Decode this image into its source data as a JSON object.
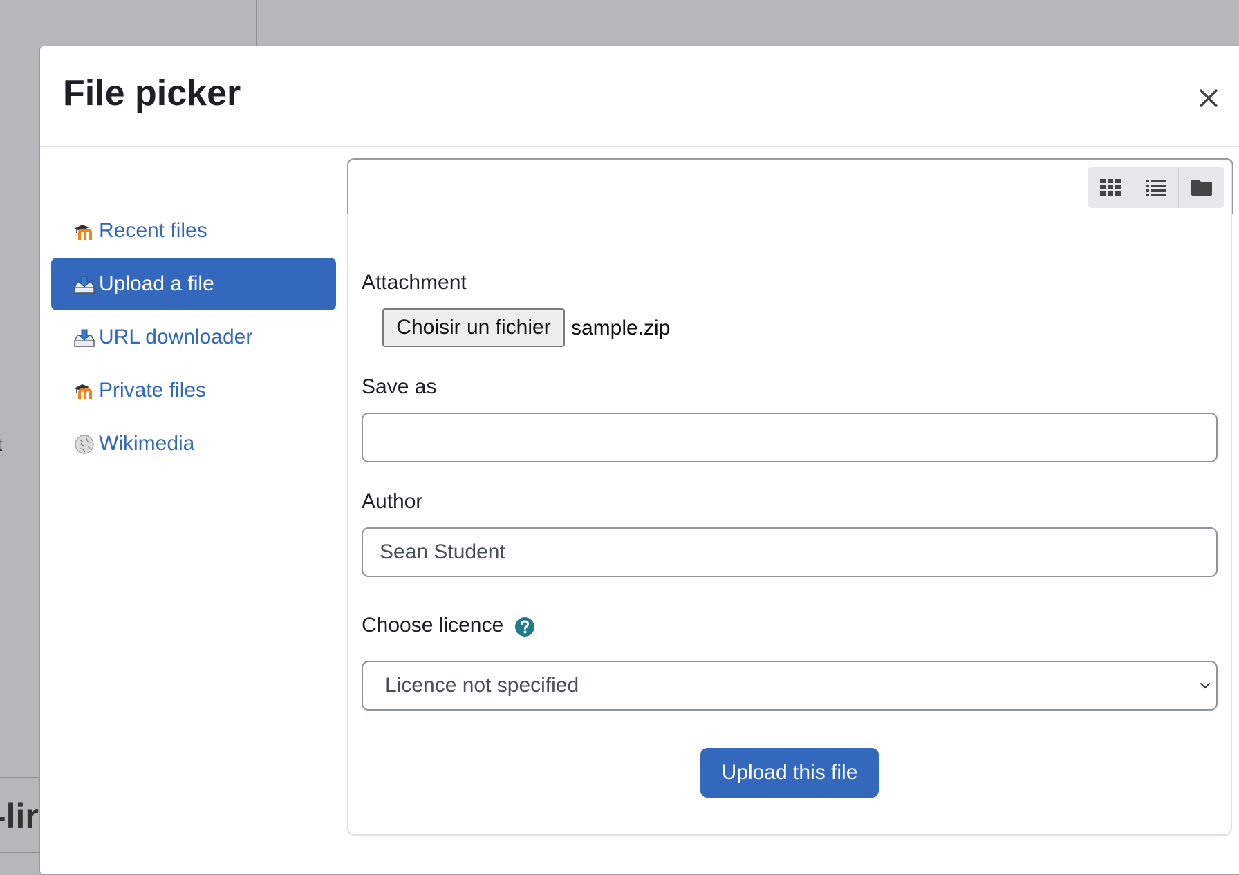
{
  "background": {
    "partial_text_bottom": "-lir",
    "partial_text_mid": "t"
  },
  "dialog": {
    "title": "File picker",
    "close_label": "×"
  },
  "repositories": [
    {
      "label": "Recent files",
      "icon": "moodle-icon",
      "active": false
    },
    {
      "label": "Upload a file",
      "icon": "upload-icon",
      "active": true
    },
    {
      "label": "URL downloader",
      "icon": "url-download-icon",
      "active": false
    },
    {
      "label": "Private files",
      "icon": "moodle-icon",
      "active": false
    },
    {
      "label": "Wikimedia",
      "icon": "wikimedia-icon",
      "active": false
    }
  ],
  "view_buttons": [
    "grid-view-icon",
    "list-view-icon",
    "folder-view-icon"
  ],
  "form": {
    "attachment_label": "Attachment",
    "choose_file_button": "Choisir un fichier",
    "chosen_file": "sample.zip",
    "save_as_label": "Save as",
    "save_as_value": "",
    "author_label": "Author",
    "author_value": "Sean Student",
    "licence_label": "Choose licence",
    "licence_value": "Licence not specified",
    "submit_label": "Upload this file"
  },
  "colors": {
    "primary": "#3368bc",
    "help_icon": "#1f7a8c",
    "overlay": "#b6b7ba"
  }
}
